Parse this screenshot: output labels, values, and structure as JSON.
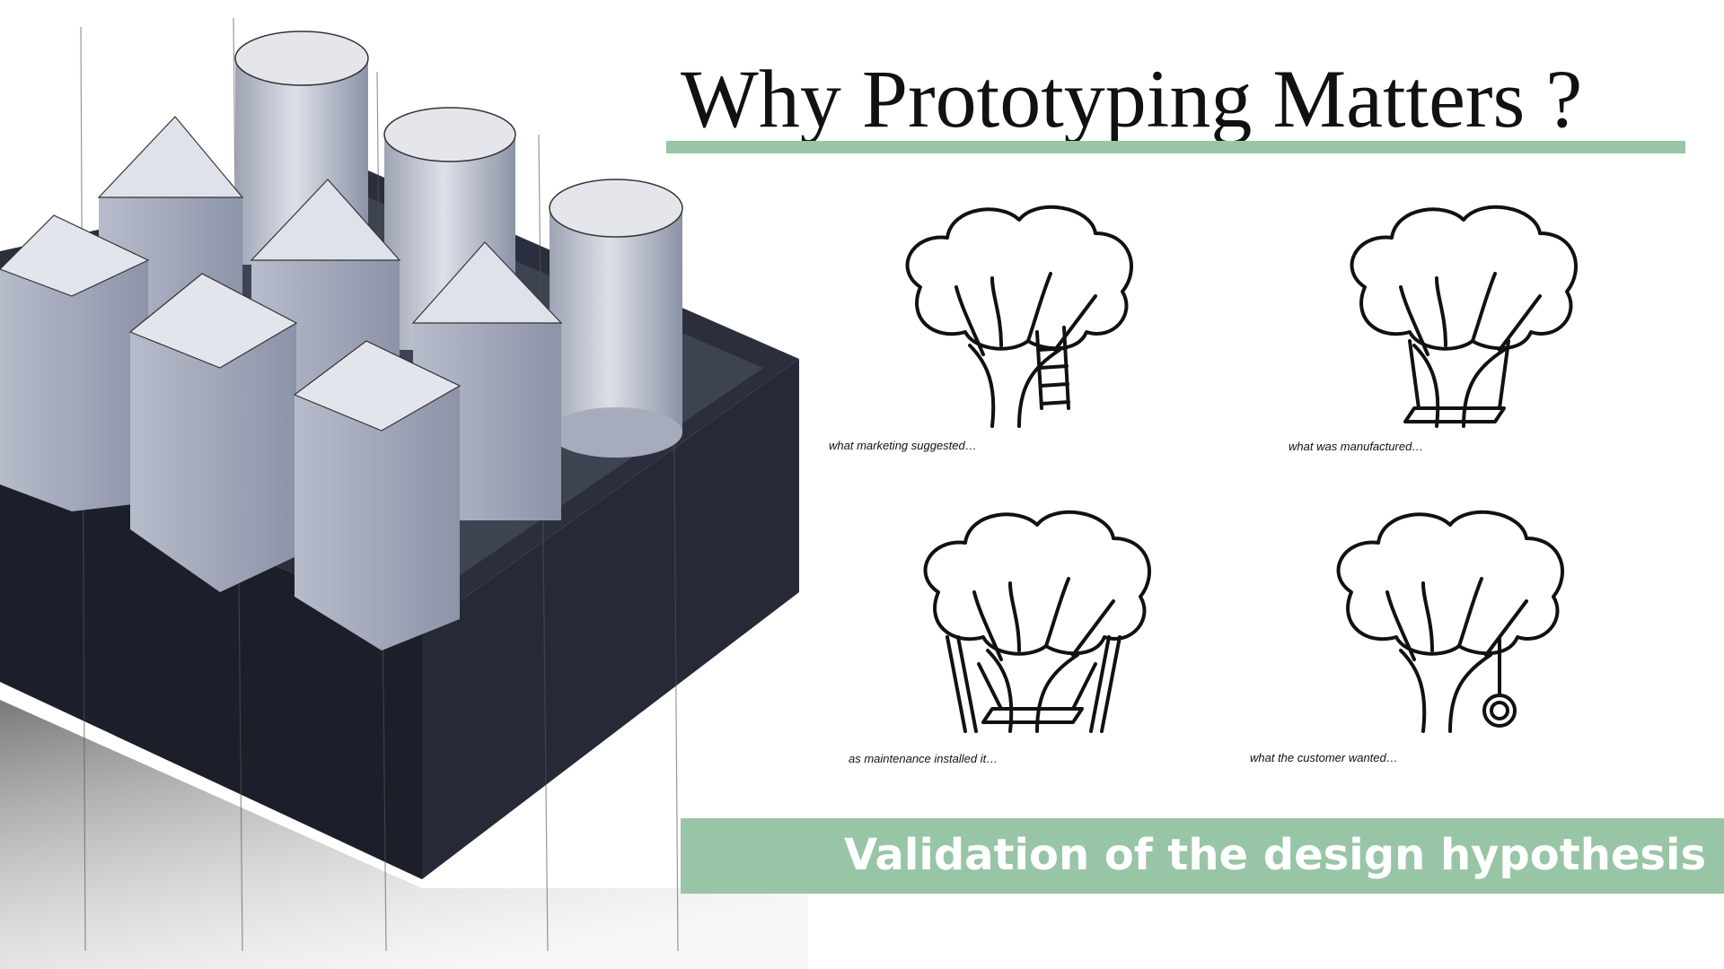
{
  "title": "Why Prototyping Matters ?",
  "colors": {
    "accent": "#98c5a6",
    "title_text": "#111111",
    "banner_text": "#ffffff"
  },
  "panels": [
    {
      "caption": "what marketing suggested…",
      "attachment": "ladder"
    },
    {
      "caption": "what was manufactured…",
      "attachment": "swing-through-trunk"
    },
    {
      "caption": "as maintenance installed it…",
      "attachment": "propped-swing"
    },
    {
      "caption": "what the customer wanted…",
      "attachment": "tire-swing"
    }
  ],
  "banner": {
    "text": "Validation of the design hypothesis"
  },
  "illustration": {
    "subject": "sketched blocks in a tray"
  }
}
